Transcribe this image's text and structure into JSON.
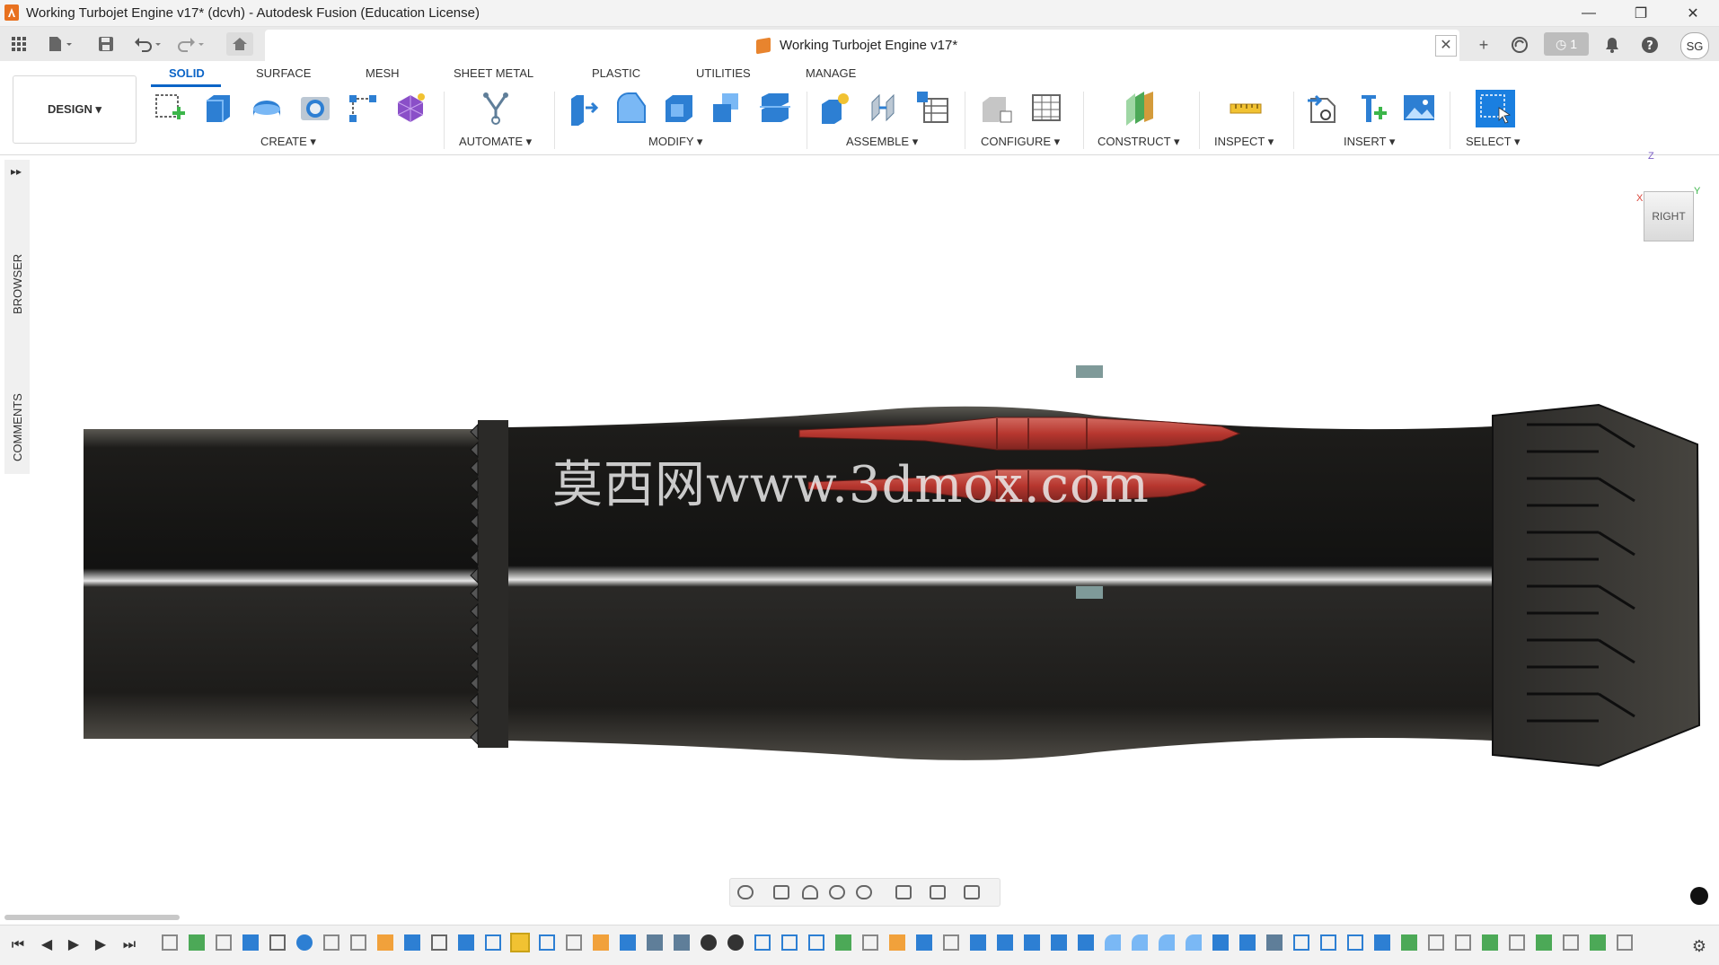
{
  "window": {
    "title": "Working Turbojet Engine v17* (dcvh) - Autodesk Fusion (Education License)",
    "minimize": "—",
    "restore": "❐",
    "close": "✕"
  },
  "tabbar": {
    "doc_title": "Working Turbojet Engine v17*",
    "close_label": "✕",
    "new_tab": "+",
    "jobs_count": "1",
    "user_initials": "SG"
  },
  "ribbon": {
    "workspace": "DESIGN ▾",
    "tabs": [
      {
        "label": "SOLID",
        "active": true
      },
      {
        "label": "SURFACE"
      },
      {
        "label": "MESH"
      },
      {
        "label": "SHEET METAL"
      },
      {
        "label": "PLASTIC"
      },
      {
        "label": "UTILITIES"
      },
      {
        "label": "MANAGE"
      }
    ],
    "groups": [
      {
        "label": "CREATE ▾"
      },
      {
        "label": "AUTOMATE ▾"
      },
      {
        "label": "MODIFY ▾"
      },
      {
        "label": "ASSEMBLE ▾"
      },
      {
        "label": "CONFIGURE ▾"
      },
      {
        "label": "CONSTRUCT ▾"
      },
      {
        "label": "INSPECT ▾"
      },
      {
        "label": "INSERT ▾"
      },
      {
        "label": "SELECT ▾"
      }
    ]
  },
  "side_panel": {
    "browser": "BROWSER",
    "comments": "COMMENTS",
    "expand": "▸▸"
  },
  "viewcube": {
    "face": "RIGHT",
    "axis_z": "Z",
    "axis_y": "Y",
    "axis_x": "X"
  },
  "watermark": "莫西网www.3dmox.com",
  "colors": {
    "accent": "#0b64c7",
    "engine_body": "#1d1c1a",
    "red_parts": "#c0443b"
  }
}
